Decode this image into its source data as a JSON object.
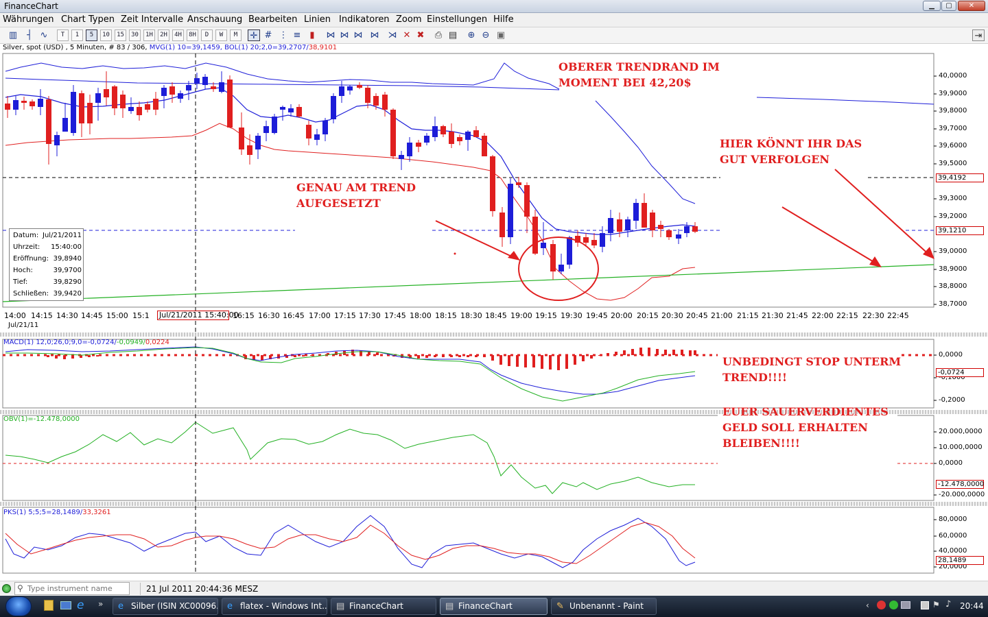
{
  "window": {
    "title": "FinanceChart",
    "minimize": "▁",
    "maximize": "▢",
    "close": "✕"
  },
  "menu": [
    "Währungen",
    "Chart Typen",
    "Zeit Intervalle",
    "Anschauung",
    "Bearbeiten",
    "Linien",
    "Indikatoren",
    "Zoom",
    "Einstellungen",
    "Hilfe"
  ],
  "toolbar": {
    "intervals": [
      "T",
      "1",
      "5",
      "10",
      "15",
      "30",
      "1H",
      "2H",
      "4H",
      "8H",
      "D",
      "W",
      "M"
    ],
    "icons": [
      "candlestick-icon",
      "bar-chart-icon",
      "line-chart-icon",
      "crosshair-icon",
      "grid-icon",
      "indicator-icon",
      "volume-icon",
      "trendline-icon",
      "fibonacci-icon",
      "channel-icon",
      "delete-icon",
      "delete-all-icon",
      "print-icon",
      "print-preview-icon",
      "zoom-in-icon",
      "zoom-out-icon",
      "zoom-reset-icon"
    ]
  },
  "info_line": {
    "instrument": "Silver, spot (USD) , 5 Minuten, # 83 / 306,",
    "mvg": "MVG(1) 10=39,1459,",
    "bol": "BOL(1) 20;2,0=39,2707/",
    "bol_low": "38,9101"
  },
  "price_axis": {
    "labels": [
      "40,0000",
      "39,9000",
      "39,8000",
      "39,7000",
      "39,6000",
      "39,5000",
      "39,3000",
      "39,2000",
      "39,0000",
      "38,9000",
      "38,8000",
      "38,7000"
    ],
    "marker_upper": "39,4192",
    "marker_current": "39,1210"
  },
  "time_axis": {
    "labels": [
      "14:00",
      "14:15",
      "14:30",
      "14:45",
      "15:00",
      "15:1",
      "0",
      "16:15",
      "16:30",
      "16:45",
      "17:00",
      "17:15",
      "17:30",
      "17:45",
      "18:00",
      "18:15",
      "18:30",
      "18:45",
      "19:00",
      "19:15",
      "19:30",
      "19:45",
      "20:00",
      "20:15",
      "20:30",
      "20:45",
      "21:00",
      "21:15",
      "21:30",
      "21:45",
      "22:00",
      "22:15",
      "22:30",
      "22:45"
    ],
    "cursor_tag": "Jul/21/2011 15:40:00",
    "date": "Jul/21/11"
  },
  "info_box": {
    "rows": [
      {
        "k": "Datum:",
        "v": "Jul/21/2011"
      },
      {
        "k": "Uhrzeit:",
        "v": "15:40:00"
      },
      {
        "k": "Eröffnung:",
        "v": "39,8940"
      },
      {
        "k": "Hoch:",
        "v": "39,9700"
      },
      {
        "k": "Tief:",
        "v": "39,8290"
      },
      {
        "k": "Schließen:",
        "v": "39,9420"
      }
    ]
  },
  "annotations": {
    "upper_trend": [
      "OBERER TRENDRAND IM",
      "MOMENT BEI 42,20$"
    ],
    "on_trend": [
      "GENAU AM TREND",
      "AUFGESETZT"
    ],
    "follow": [
      "HIER KÖNNT IHR DAS",
      "GUT VERFOLGEN"
    ],
    "stop": [
      "UNBEDINGT STOP UNTERM",
      "TREND!!!!"
    ],
    "money": [
      "EUER SAUERVERDIENTES",
      "GELD SOLL ERHALTEN",
      "BLEIBEN!!!!"
    ]
  },
  "macd": {
    "title_main": "MACD(1) 12,0;26,0;9,0=-0,0724/",
    "title_signal": "-0,0949/",
    "title_hist": "0,0224",
    "axis": [
      "0,0000",
      "-0,1000",
      "-0,2000"
    ],
    "marker": "-0,0724"
  },
  "obv": {
    "title": "OBV(1)=-12.478,0000",
    "axis": [
      "20.000,0000",
      "10.000,0000",
      "0,0000",
      "-20.000,0000"
    ],
    "marker": "-12.478,0000"
  },
  "pks": {
    "title_main": "PKS(1) 5;5;5=28,1489/",
    "title_red": "33,3261",
    "axis": [
      "80,0000",
      "60,0000",
      "40,0000",
      "20,0000"
    ],
    "marker": "28,1489"
  },
  "status": {
    "search_placeholder": "Type instrument name",
    "datetime": "21 Jul 2011 20:44:36 MESZ"
  },
  "taskbar": {
    "tasks": [
      {
        "label": "Silber (ISIN XC00096...",
        "icon": "ie-icon"
      },
      {
        "label": "flatex - Windows Int...",
        "icon": "ie-icon"
      },
      {
        "label": "FinanceChart",
        "icon": "chart-icon"
      },
      {
        "label": "FinanceChart",
        "icon": "chart-icon"
      },
      {
        "label": "Unbenannt - Paint",
        "icon": "paint-icon"
      }
    ],
    "clock": "20:44"
  },
  "colors": {
    "bull": "#1d1dd8",
    "bear": "#e01f1f",
    "trend": "#22b022",
    "note": "#e01f1f"
  }
}
